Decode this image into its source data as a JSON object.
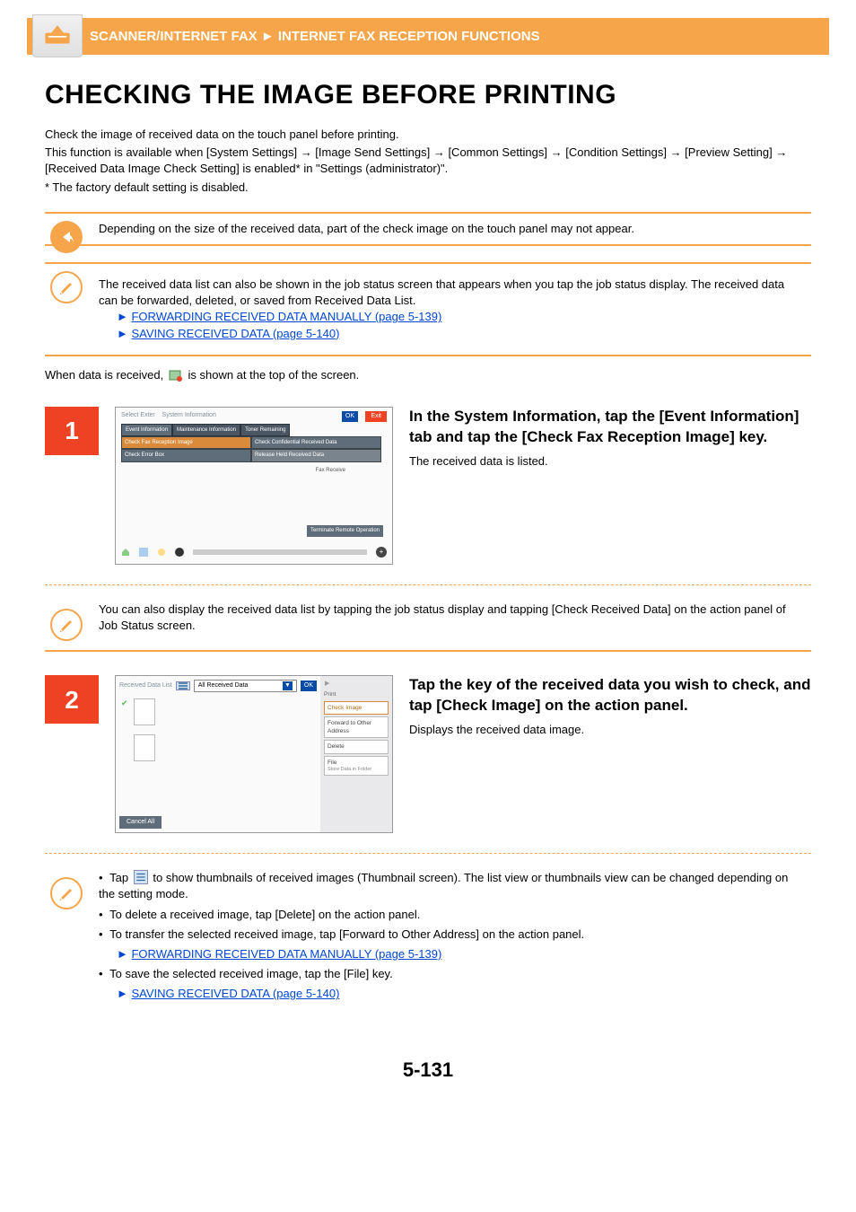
{
  "header": {
    "breadcrumb_left": "SCANNER/INTERNET FAX",
    "breadcrumb_sep": "►",
    "breadcrumb_right": "INTERNET FAX RECEPTION FUNCTIONS"
  },
  "title": "CHECKING THE IMAGE BEFORE PRINTING",
  "intro": {
    "p1": "Check the image of received data on the touch panel before printing.",
    "p2": "This function is available when [System Settings] → [Image Send Settings] → [Common Settings] → [Condition Settings] → [Preview Setting] → [Received Data Image Check Setting] is enabled* in \"Settings (administrator)\".",
    "p3": "* The factory default setting is disabled."
  },
  "notice1": "Depending on the size of the received data, part of the check image on the touch panel may not appear.",
  "notice2": {
    "text": "The received data list can also be shown in the job status screen that appears when you tap the job status display. The received data can be forwarded, deleted, or saved from Received Data List.",
    "link1": "FORWARDING RECEIVED DATA MANUALLY (page 5-139)",
    "link2": "SAVING RECEIVED DATA (page 5-140)"
  },
  "after_notice": {
    "before_icon": "When data is received, ",
    "after_icon": " is shown at the top of the screen."
  },
  "step1": {
    "num": "1",
    "heading": "In the System Information, tap the [Event Information] tab and tap the [Check Fax Reception Image] key.",
    "body": "The received data is listed.",
    "shot": {
      "top_left": "Select Exter",
      "sys_info": "System Information",
      "ok": "OK",
      "exit": "Exit",
      "tab1": "Event Information",
      "tab2": "Maintenance Information",
      "tab3": "Toner Remaining",
      "btn1": "Check Fax Reception Image",
      "btn2": "Check Confidential Received Data",
      "btn3": "Check Error Box",
      "btn4": "Release Held Received Data",
      "fax_receive": "Fax Receive",
      "terminate": "Terminate Remote Operation"
    }
  },
  "tip1": "You can also display the received data list by tapping the job status display and tapping [Check Received Data] on the action panel of Job Status screen.",
  "step2": {
    "num": "2",
    "heading": "Tap the key of the received data you wish to check, and tap [Check Image] on the action panel.",
    "body": "Displays the received data image.",
    "shot": {
      "title": "Received Data List",
      "dropdown": "All Received Data",
      "ok": "OK",
      "act_header": "Print",
      "act1": "Check Image",
      "act2": "Forward to Other Address",
      "act3": "Delete",
      "act4": "File",
      "act4_sub": "Store Data in Folder",
      "cancel": "Cancel All"
    }
  },
  "tip2": {
    "l1a": "Tap ",
    "l1b": " to show thumbnails of received images (Thumbnail screen). The list view or thumbnails view can be changed depending on the setting mode.",
    "l2": "To delete a received image, tap [Delete] on the action panel.",
    "l3": "To transfer the selected received image, tap [Forward to Other Address] on the action panel.",
    "l3_link": "FORWARDING RECEIVED DATA MANUALLY (page 5-139)",
    "l4": "To save the selected received image, tap the [File] key.",
    "l4_link": "SAVING RECEIVED DATA (page 5-140)"
  },
  "page_number": "5-131"
}
